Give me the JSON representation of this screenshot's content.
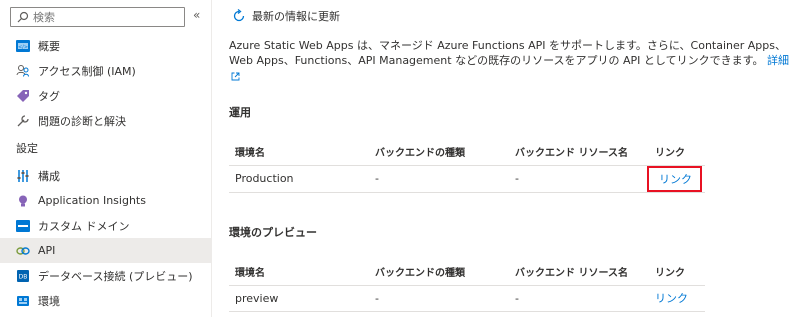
{
  "sidebar": {
    "search_placeholder": "検索",
    "collapse_glyph": "«",
    "items_top": [
      {
        "label": "概要",
        "icon": "overview-icon"
      },
      {
        "label": "アクセス制御 (IAM)",
        "icon": "people-icon"
      },
      {
        "label": "タグ",
        "icon": "tag-icon"
      },
      {
        "label": "問題の診断と解決",
        "icon": "wrench-icon"
      }
    ],
    "section_label": "設定",
    "items_settings": [
      {
        "label": "構成",
        "icon": "sliders-icon"
      },
      {
        "label": "Application Insights",
        "icon": "lightbulb-icon"
      },
      {
        "label": "カスタム ドメイン",
        "icon": "domain-icon"
      },
      {
        "label": "API",
        "icon": "api-icon",
        "selected": true
      },
      {
        "label": "データベース接続 (プレビュー)",
        "icon": "database-icon"
      },
      {
        "label": "環境",
        "icon": "environment-icon"
      }
    ]
  },
  "toolbar": {
    "refresh_label": "最新の情報に更新"
  },
  "main": {
    "description": "Azure Static Web Apps は、マネージド Azure Functions API をサポートします。さらに、Container Apps、Web Apps、Functions、API Management などの既存のリソースをアプリの API としてリンクできます。",
    "more_link": "詳細"
  },
  "production_section": {
    "title": "運用",
    "headers": [
      "環境名",
      "バックエンドの種類",
      "バックエンド リソース名",
      "リンク"
    ],
    "rows": [
      {
        "env": "Production",
        "type": "-",
        "resource": "-",
        "link": "リンク"
      }
    ]
  },
  "preview_section": {
    "title": "環境のプレビュー",
    "headers": [
      "環境名",
      "バックエンドの種類",
      "バックエンド リソース名",
      "リンク"
    ],
    "rows": [
      {
        "env": "preview",
        "type": "-",
        "resource": "-",
        "link": "リンク"
      }
    ]
  },
  "colors": {
    "accent": "#0078d4",
    "highlight": "#e81123",
    "selected_bg": "#edebe9"
  }
}
